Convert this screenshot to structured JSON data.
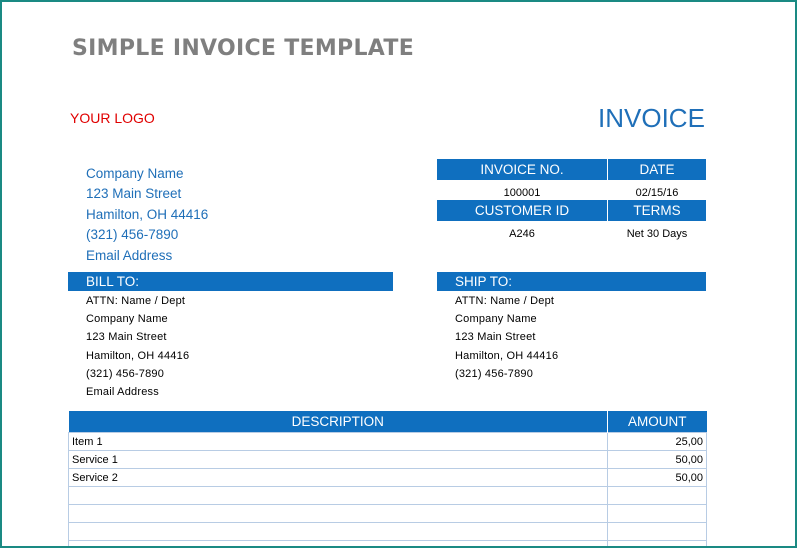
{
  "title": "SIMPLE INVOICE TEMPLATE",
  "logo": "YOUR LOGO",
  "heading": "INVOICE",
  "company": {
    "name": "Company Name",
    "street": "123 Main Street",
    "city": "Hamilton, OH  44416",
    "phone": "(321) 456-7890",
    "email": "Email Address"
  },
  "meta": {
    "invoice_no_label": "INVOICE NO.",
    "date_label": "DATE",
    "invoice_no": "100001",
    "date": "02/15/16",
    "customer_id_label": "CUSTOMER ID",
    "terms_label": "TERMS",
    "customer_id": "A246",
    "terms": "Net 30 Days"
  },
  "bill_to": {
    "label": "BILL TO:",
    "lines": [
      "ATTN: Name / Dept",
      "Company Name",
      "123 Main Street",
      "Hamilton, OH  44416",
      "(321) 456-7890",
      "Email Address"
    ]
  },
  "ship_to": {
    "label": "SHIP TO:",
    "lines": [
      "ATTN: Name / Dept",
      "Company Name",
      "123 Main Street",
      "Hamilton, OH  44416",
      "(321) 456-7890"
    ]
  },
  "items": {
    "description_label": "DESCRIPTION",
    "amount_label": "AMOUNT",
    "rows": [
      {
        "description": "Item 1",
        "amount": "25,00"
      },
      {
        "description": "Service 1",
        "amount": "50,00"
      },
      {
        "description": "Service 2",
        "amount": "50,00"
      },
      {
        "description": "",
        "amount": ""
      },
      {
        "description": "",
        "amount": ""
      },
      {
        "description": "",
        "amount": ""
      },
      {
        "description": "",
        "amount": ""
      }
    ]
  },
  "colors": {
    "accent": "#0f6fbf",
    "link_text": "#1f6fb8",
    "logo": "#e00000",
    "title": "#7f7f7f",
    "frame": "#1a8a83"
  }
}
